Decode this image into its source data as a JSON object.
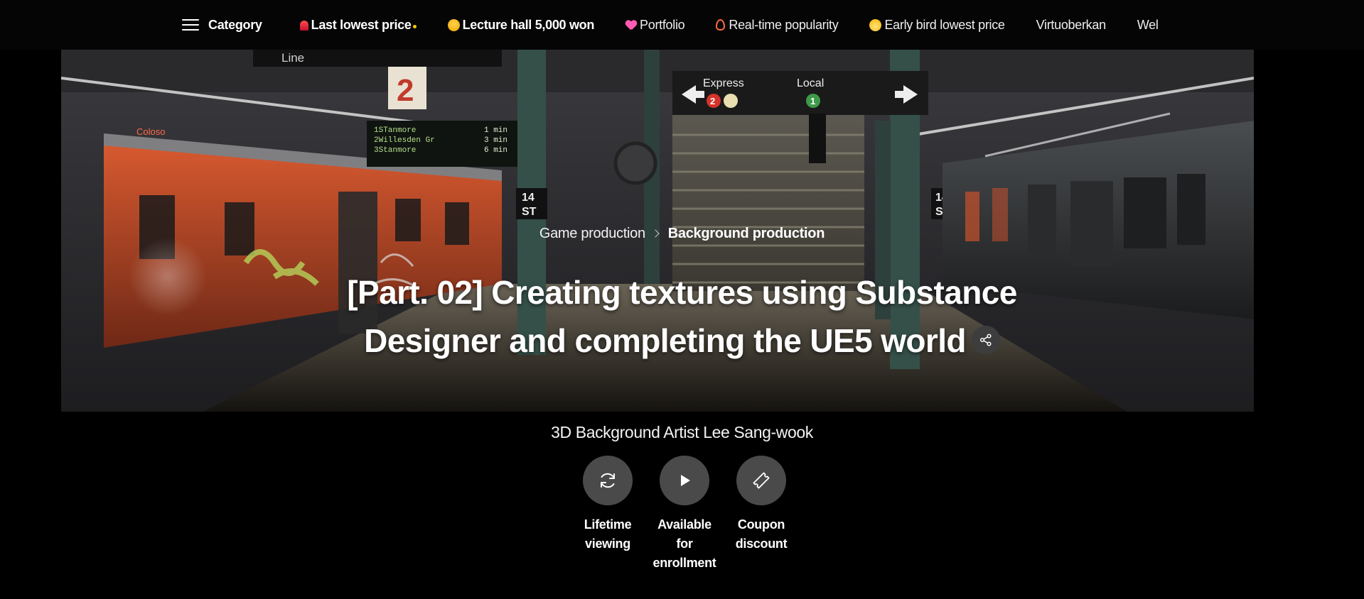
{
  "nav": {
    "category_label": "Category",
    "items": [
      {
        "label": "Last lowest price",
        "icon": "siren-icon",
        "bold": true
      },
      {
        "label": "Lecture hall 5,000 won",
        "icon": "starstruck-face-icon",
        "bold": true
      },
      {
        "label": "Portfolio",
        "icon": "heart-icon",
        "bold": false
      },
      {
        "label": "Real-time popularity",
        "icon": "fire-icon",
        "bold": false
      },
      {
        "label": "Early bird lowest price",
        "icon": "chick-icon",
        "bold": false
      },
      {
        "label": "Virtuoberkan",
        "icon": null,
        "bold": false
      },
      {
        "label": "Wel",
        "icon": null,
        "bold": false
      }
    ]
  },
  "hero": {
    "signs": {
      "line": "Line",
      "platform_number": "2",
      "express": "Express",
      "local": "Local",
      "express_badge": "2",
      "local_badge": "1",
      "station_left": "14\nST",
      "station_right": "14\nST",
      "departures": [
        "1STanmore",
        "2Willesden Gr",
        "3Stanmore"
      ],
      "departure_times": [
        "1 min",
        "3 min",
        "6 min"
      ],
      "train_logo": "Coloso"
    }
  },
  "breadcrumb": {
    "parent": "Game production",
    "current": "Background production"
  },
  "course": {
    "title": "[Part. 02] Creating textures using Substance Designer and completing the UE5 world",
    "author": "3D Background Artist Lee Sang-wook"
  },
  "features": [
    {
      "icon": "refresh-icon",
      "label_lines": [
        "Lifetime",
        "viewing"
      ]
    },
    {
      "icon": "play-icon",
      "label_lines": [
        "Available",
        "for",
        "enrollment"
      ]
    },
    {
      "icon": "ticket-icon",
      "label_lines": [
        "Coupon",
        "discount"
      ]
    }
  ],
  "colors": {
    "background": "#000000",
    "nav_background": "#050505",
    "feature_circle": "#4a4a4a",
    "train_orange": "#c9512b",
    "accent_yellow": "#ffc700"
  }
}
